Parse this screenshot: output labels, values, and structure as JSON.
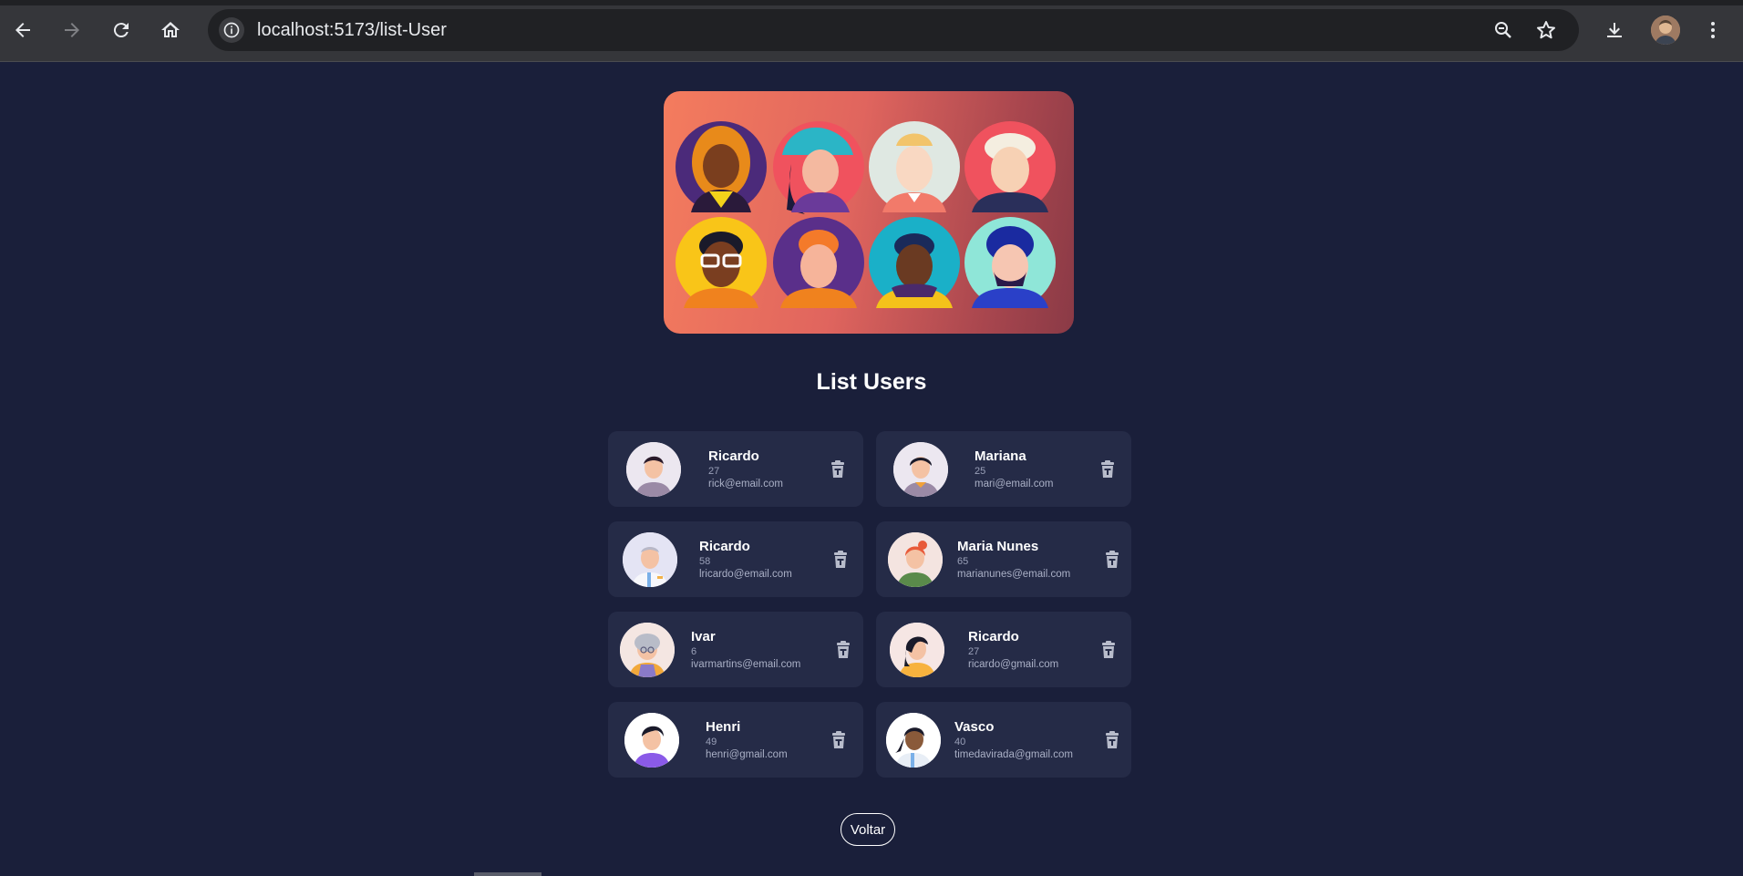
{
  "browser": {
    "url": "localhost:5173/list-User",
    "icons": [
      "back-arrow-icon",
      "forward-arrow-icon",
      "reload-icon",
      "home-icon",
      "site-info-icon",
      "zoom-icon",
      "star-icon",
      "download-icon",
      "profile-avatar",
      "kebab-menu-icon"
    ]
  },
  "page": {
    "title": "List Users",
    "back_label": "Voltar"
  },
  "users": [
    {
      "name": "Ricardo",
      "age": "27",
      "email": "rick@email.com"
    },
    {
      "name": "Mariana",
      "age": "25",
      "email": "mari@email.com"
    },
    {
      "name": "Ricardo",
      "age": "58",
      "email": "lricardo@email.com"
    },
    {
      "name": "Maria Nunes",
      "age": "65",
      "email": "marianunes@email.com"
    },
    {
      "name": "Ivar",
      "age": "6",
      "email": "ivarmartins@email.com"
    },
    {
      "name": "Ricardo",
      "age": "27",
      "email": "ricardo@gmail.com"
    },
    {
      "name": "Henri",
      "age": "49",
      "email": "henri@gmail.com"
    },
    {
      "name": "Vasco",
      "age": "40",
      "email": "timedavirada@gmail.com"
    }
  ],
  "colors": {
    "background": "#1a1f3a",
    "card": "#252b47",
    "hero_gradient_start": "#f47c5e",
    "hero_gradient_end": "#8a3a46"
  }
}
